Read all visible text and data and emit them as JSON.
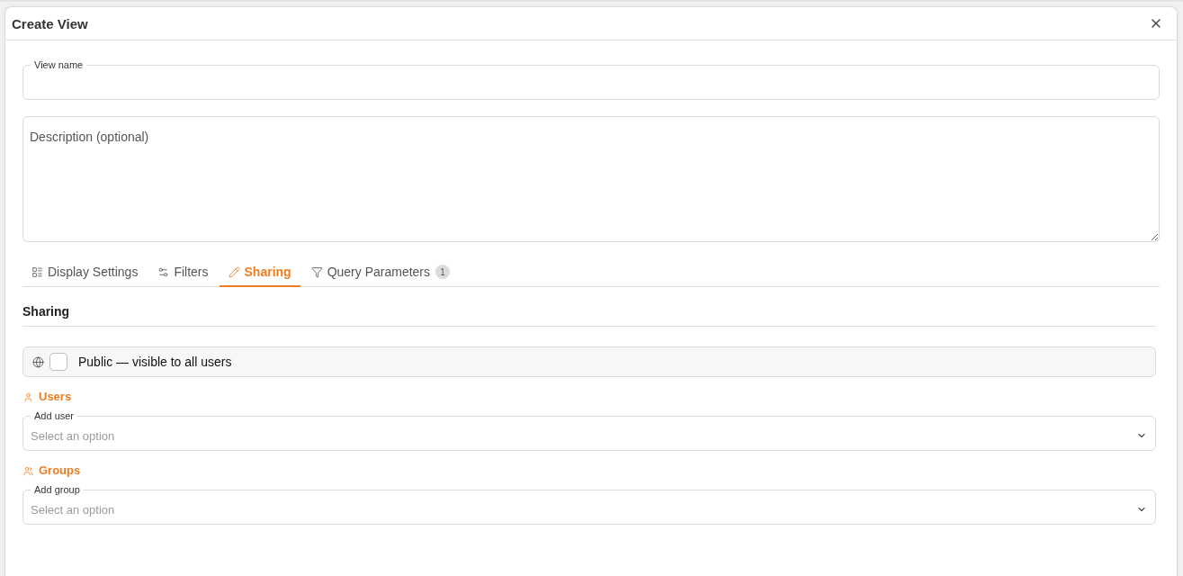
{
  "dialog": {
    "title": "Create View"
  },
  "form": {
    "view_name": {
      "label": "View name"
    },
    "description": {
      "placeholder": "Description (optional)"
    }
  },
  "tabs": [
    {
      "label": "Display Settings",
      "selected": false
    },
    {
      "label": "Filters",
      "selected": false
    },
    {
      "label": "Sharing",
      "selected": true
    },
    {
      "label": "Query Parameters",
      "selected": false,
      "badge": "1"
    }
  ],
  "sharing": {
    "heading": "Sharing",
    "public": {
      "label": "Public — visible to all users",
      "checked": false
    },
    "sections": [
      {
        "kind": "users",
        "title": "Users",
        "field_label": "Add user",
        "placeholder": "Select an option"
      },
      {
        "kind": "groups",
        "title": "Groups",
        "field_label": "Add group",
        "placeholder": "Select an option"
      }
    ]
  }
}
